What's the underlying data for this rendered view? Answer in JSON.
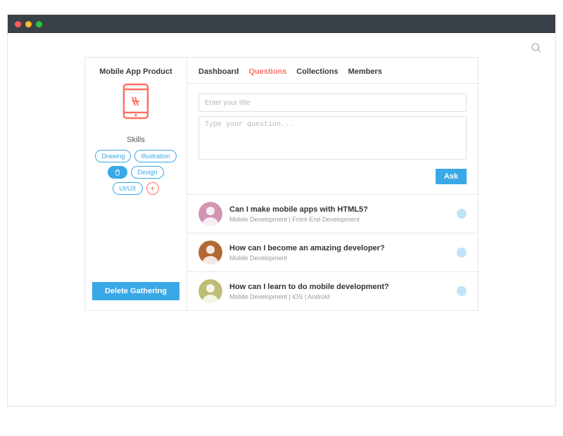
{
  "sidebar": {
    "title": "Mobile App Product",
    "skills_label": "Skills",
    "chips": [
      "Drawing",
      "Illustration",
      "",
      "Design",
      "UI/UX"
    ],
    "delete_label": "Delete Gathering"
  },
  "tabs": [
    "Dashboard",
    "Questions",
    "Collections",
    "Members"
  ],
  "active_tab_index": 1,
  "compose": {
    "title_placeholder": "Enter your title",
    "body_placeholder": "Type your question...",
    "ask_label": "Ask"
  },
  "questions": [
    {
      "title": "Can I make mobile apps with HTML5?",
      "meta": "Mobile Development | Front-End Development",
      "avatar_hue": 330
    },
    {
      "title": "How can I become an amazing developer?",
      "meta": "Mobile Development",
      "avatar_hue": 25
    },
    {
      "title": "How can I learn to do mobile development?",
      "meta": "Mobile Development | iOS | Android",
      "avatar_hue": 60
    }
  ]
}
